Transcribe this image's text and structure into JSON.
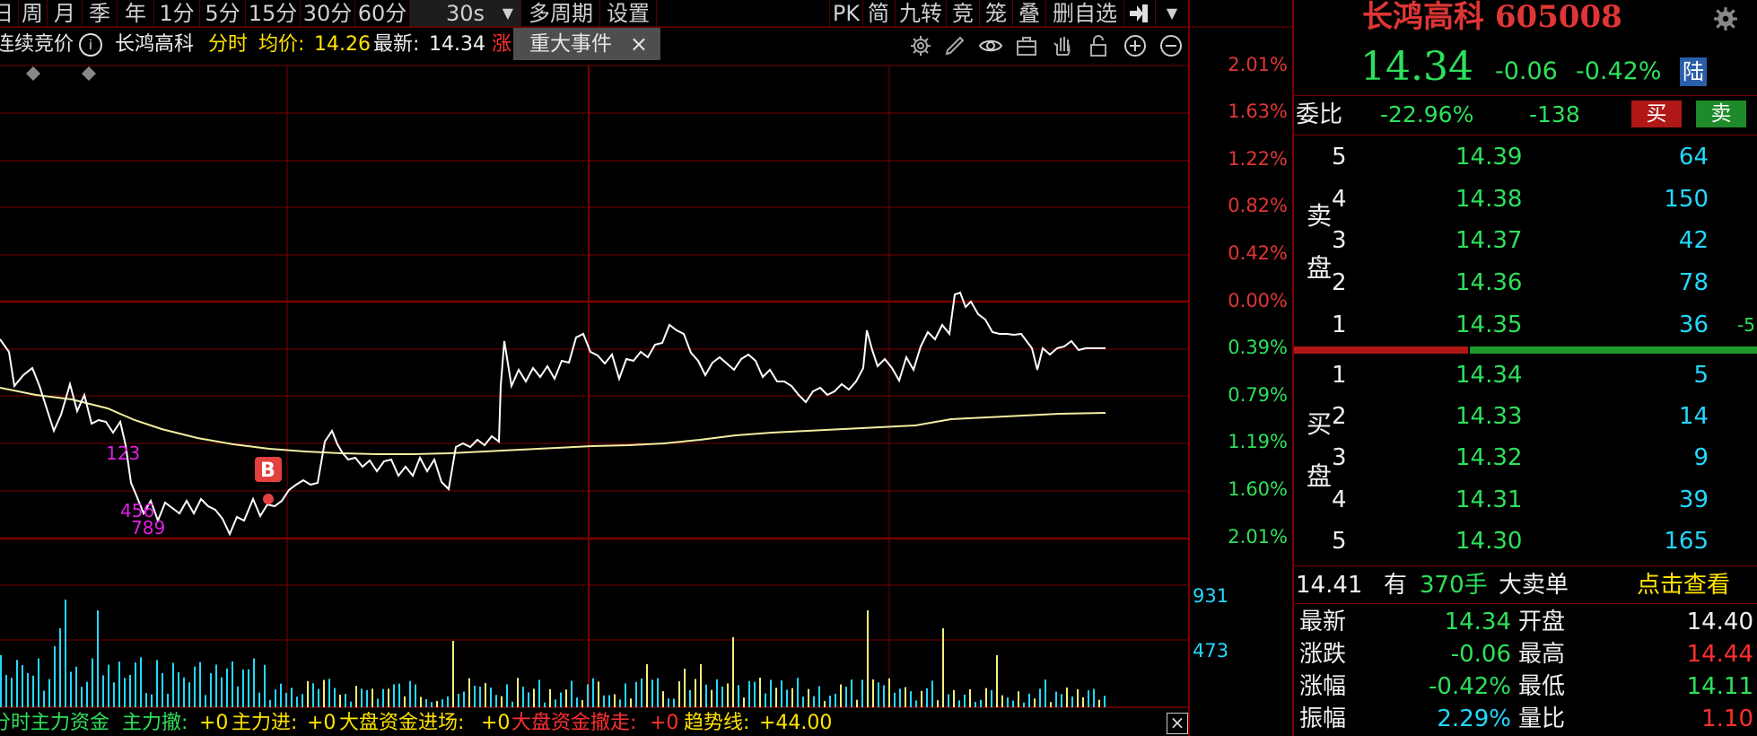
{
  "toolbar": {
    "items": [
      "日",
      "周",
      "月",
      "季",
      "年",
      "1分",
      "5分",
      "15分",
      "30分",
      "60分",
      "30s",
      "多周期",
      "设置"
    ],
    "right_items": [
      "PK",
      "简",
      "九转",
      "竞",
      "笼",
      "叠",
      "删自选"
    ]
  },
  "info_row": {
    "auction": "连续竞价",
    "stock_name": "长鸿高科",
    "mode": "分时",
    "avg_label": "均价:",
    "avg_value": "14.26",
    "last_label": "最新:",
    "last_value": "14.34",
    "extra": "涨",
    "event_tab": "重大事件",
    "close_glyph": "×"
  },
  "axis_pct": [
    "2.01%",
    "1.63%",
    "1.22%",
    "0.82%",
    "0.42%",
    "0.00%",
    "0.39%",
    "0.79%",
    "1.19%",
    "1.60%",
    "2.01%"
  ],
  "volume_axis": [
    "931",
    "473"
  ],
  "markers": {
    "b_label": "B",
    "nums1": "123",
    "nums2": "456",
    "nums3": "789"
  },
  "footer": {
    "title": "分时主力资金",
    "items": [
      {
        "label": "主力撤:",
        "value": "+0"
      },
      {
        "label": "主力进:",
        "value": "+0"
      },
      {
        "label": "大盘资金进场:",
        "value": "+0"
      },
      {
        "label": "大盘资金撤走:",
        "value": "+0"
      },
      {
        "label": "趋势线:",
        "value": "+44.00"
      }
    ],
    "close_glyph": "×"
  },
  "panel": {
    "title": "长鸿高科 605008",
    "price": "14.34",
    "change": "-0.06",
    "change_pct": "-0.42%",
    "exchange_tag": "陆",
    "weibi_label": "委比",
    "weibi_value": "-22.96%",
    "weicha_value": "-138",
    "buy_btn": "买",
    "sell_btn": "卖",
    "sell_side_label": "卖盘",
    "buy_side_label": "买盘",
    "asks": [
      {
        "level": "5",
        "price": "14.39",
        "vol": "64",
        "extra": ""
      },
      {
        "level": "4",
        "price": "14.38",
        "vol": "150",
        "extra": ""
      },
      {
        "level": "3",
        "price": "14.37",
        "vol": "42",
        "extra": ""
      },
      {
        "level": "2",
        "price": "14.36",
        "vol": "78",
        "extra": ""
      },
      {
        "level": "1",
        "price": "14.35",
        "vol": "36",
        "extra": "-5"
      }
    ],
    "bids": [
      {
        "level": "1",
        "price": "14.34",
        "vol": "5"
      },
      {
        "level": "2",
        "price": "14.33",
        "vol": "14"
      },
      {
        "level": "3",
        "price": "14.32",
        "vol": "9"
      },
      {
        "level": "4",
        "price": "14.31",
        "vol": "39"
      },
      {
        "level": "5",
        "price": "14.30",
        "vol": "165"
      }
    ],
    "notice_price": "14.41",
    "notice_text": "有",
    "notice_qty": "370手",
    "notice_type": "大卖单",
    "notice_link": "点击查看",
    "stats": [
      {
        "l1": "最新",
        "v1": "14.34",
        "l2": "开盘",
        "v2": "14.40",
        "c1": "green",
        "c2": "white"
      },
      {
        "l1": "涨跌",
        "v1": "-0.06",
        "l2": "最高",
        "v2": "14.44",
        "c1": "green",
        "c2": "red"
      },
      {
        "l1": "涨幅",
        "v1": "-0.42%",
        "l2": "最低",
        "v2": "14.11",
        "c1": "green",
        "c2": "green"
      },
      {
        "l1": "振幅",
        "v1": "2.29%",
        "l2": "量比",
        "v2": "1.10",
        "c1": "cyan",
        "c2": "red"
      }
    ]
  },
  "colors": {
    "grid": "#7a0000",
    "price_line": "#ffffff",
    "avg_line": "#f3eea0",
    "vol_cyan": "#23d8ff",
    "vol_yellow": "#f5f07a"
  }
}
